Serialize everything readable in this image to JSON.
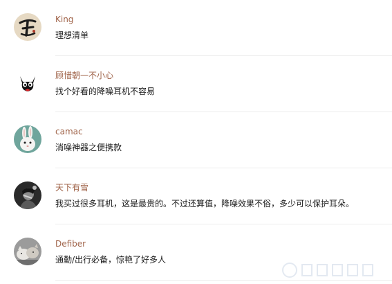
{
  "comments": [
    {
      "username": "King",
      "text": "理想清单",
      "avatar": "calligraphy-avatar"
    },
    {
      "username": "顾惜朝一不小心",
      "text": "找个好看的降噪耳机不容易",
      "avatar": "black-cat-avatar"
    },
    {
      "username": "camac",
      "text": "消噪神器之便携款",
      "avatar": "white-rabbit-avatar"
    },
    {
      "username": "天下有雪",
      "text": "我买过很多耳机，这是最贵的。不过还算值，降噪效果不俗，多少可以保护耳朵。",
      "avatar": "dark-portrait-avatar"
    },
    {
      "username": "Defiber",
      "text": "通勤/出行必备，惊艳了好多人",
      "avatar": "cat-photo-avatar"
    }
  ],
  "colors": {
    "username": "#a0644a",
    "text": "#1a1a1a",
    "divider": "#ececec"
  }
}
